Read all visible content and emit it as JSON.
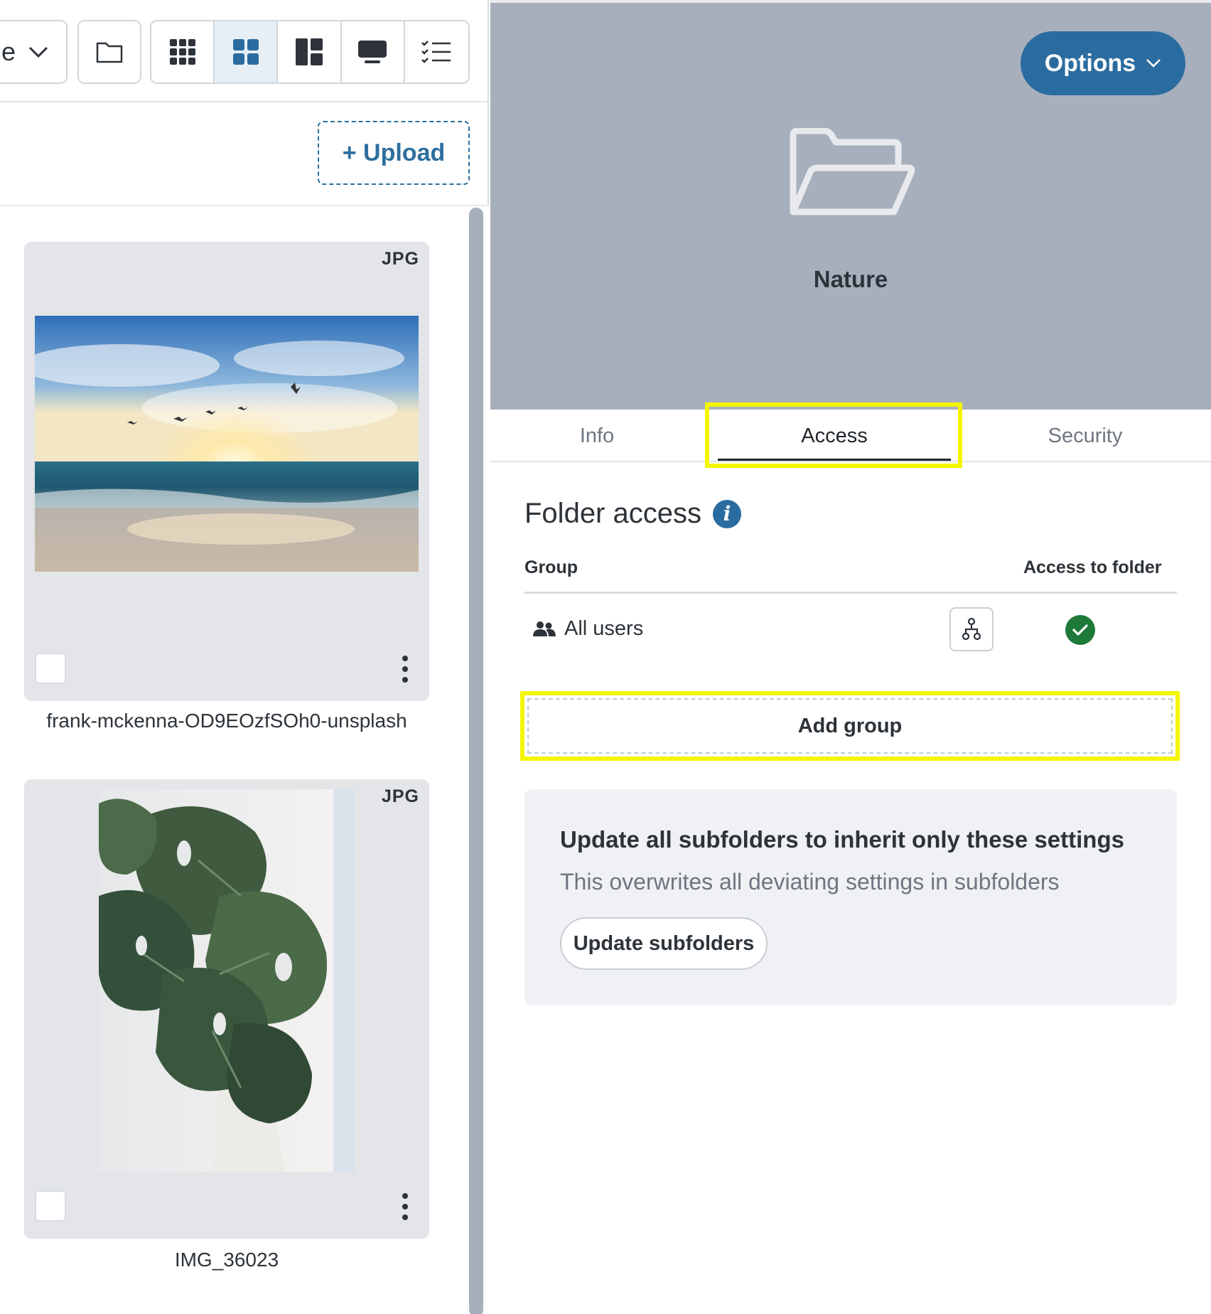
{
  "toolbar": {
    "sort_partial_label": "e",
    "upload_label": "+ Upload",
    "views": [
      "grid-small",
      "grid-medium",
      "masonry",
      "presentation",
      "list"
    ],
    "active_view": "grid-medium"
  },
  "files": [
    {
      "type": "JPG",
      "name": "frank-mckenna-OD9EOzfSOh0-unsplash"
    },
    {
      "type": "JPG",
      "name": "IMG_36023"
    }
  ],
  "folder": {
    "options_label": "Options",
    "name": "Nature"
  },
  "tabs": [
    {
      "label": "Info"
    },
    {
      "label": "Access"
    },
    {
      "label": "Security"
    }
  ],
  "access": {
    "title": "Folder access",
    "col_group": "Group",
    "col_access": "Access to folder",
    "rows": [
      {
        "group": "All users",
        "has_access": true
      }
    ],
    "add_group_label": "Add group"
  },
  "subfolders": {
    "title": "Update all subfolders to inherit only these settings",
    "description": "This overwrites all deviating settings in subfolders",
    "button_label": "Update subfolders"
  },
  "colors": {
    "accent": "#2a6c9f",
    "header_bg": "#a8afbc",
    "success": "#1f7a3a",
    "highlight": "#f5f500"
  }
}
